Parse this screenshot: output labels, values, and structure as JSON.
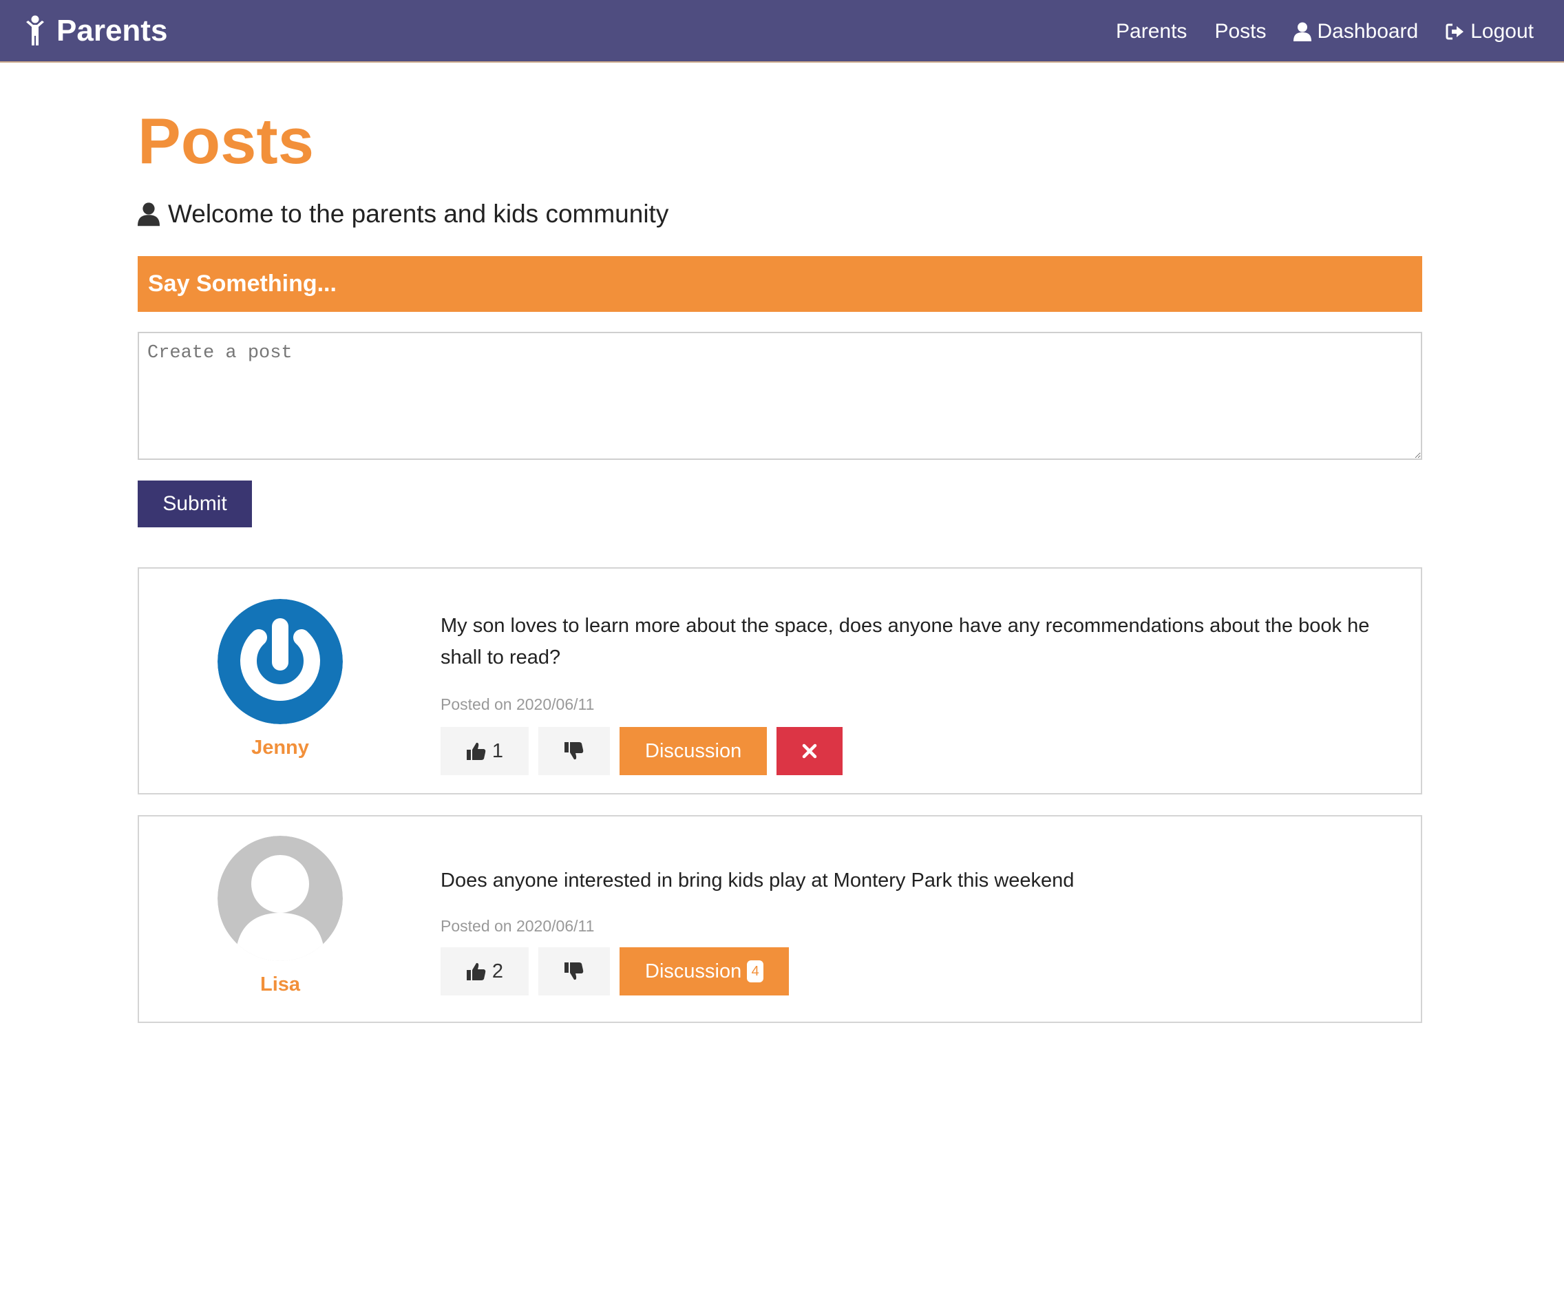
{
  "navbar": {
    "brand": "Parents",
    "links": {
      "parents": "Parents",
      "posts": "Posts",
      "dashboard": "Dashboard",
      "logout": "Logout"
    }
  },
  "page": {
    "title": "Posts",
    "lead": "Welcome to the parents and kids community"
  },
  "composer": {
    "header": "Say Something...",
    "placeholder": "Create a post",
    "submit_label": "Submit"
  },
  "posts": [
    {
      "author": "Jenny",
      "text": "My son loves to learn more about the space, does anyone have any recommendations about the book he shall to read?",
      "posted": "Posted on 2020/06/11",
      "likes": "1",
      "discussion_label": "Discussion",
      "avatar_icon": "power-logo-avatar"
    },
    {
      "author": "Lisa",
      "text": "Does anyone interested in bring kids play at Montery Park this weekend",
      "posted": "Posted on 2020/06/11",
      "likes": "2",
      "discussion_label": "Discussion",
      "discussion_count": "4",
      "avatar_icon": "default-user-avatar"
    }
  ],
  "colors": {
    "navbar": "#4f4d80",
    "accent": "#f2903a",
    "submit": "#3a3671",
    "danger": "#dc3545"
  }
}
